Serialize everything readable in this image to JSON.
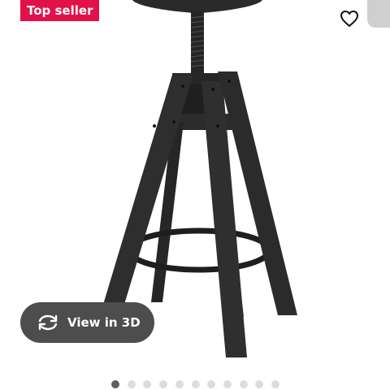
{
  "badge": {
    "label": "Top seller"
  },
  "favorite": {
    "icon": "heart-outline-icon"
  },
  "view3d": {
    "label": "View in 3D",
    "icon": "rotate-3d-icon"
  },
  "carousel": {
    "total": 11,
    "active_index": 0
  },
  "colors": {
    "badge_bg": "#e3114a",
    "button_bg": "#4d4d4d",
    "stool": "#2a2a2a",
    "dot_active": "#5e5e5e",
    "dot_inactive": "#dcdcdc"
  }
}
